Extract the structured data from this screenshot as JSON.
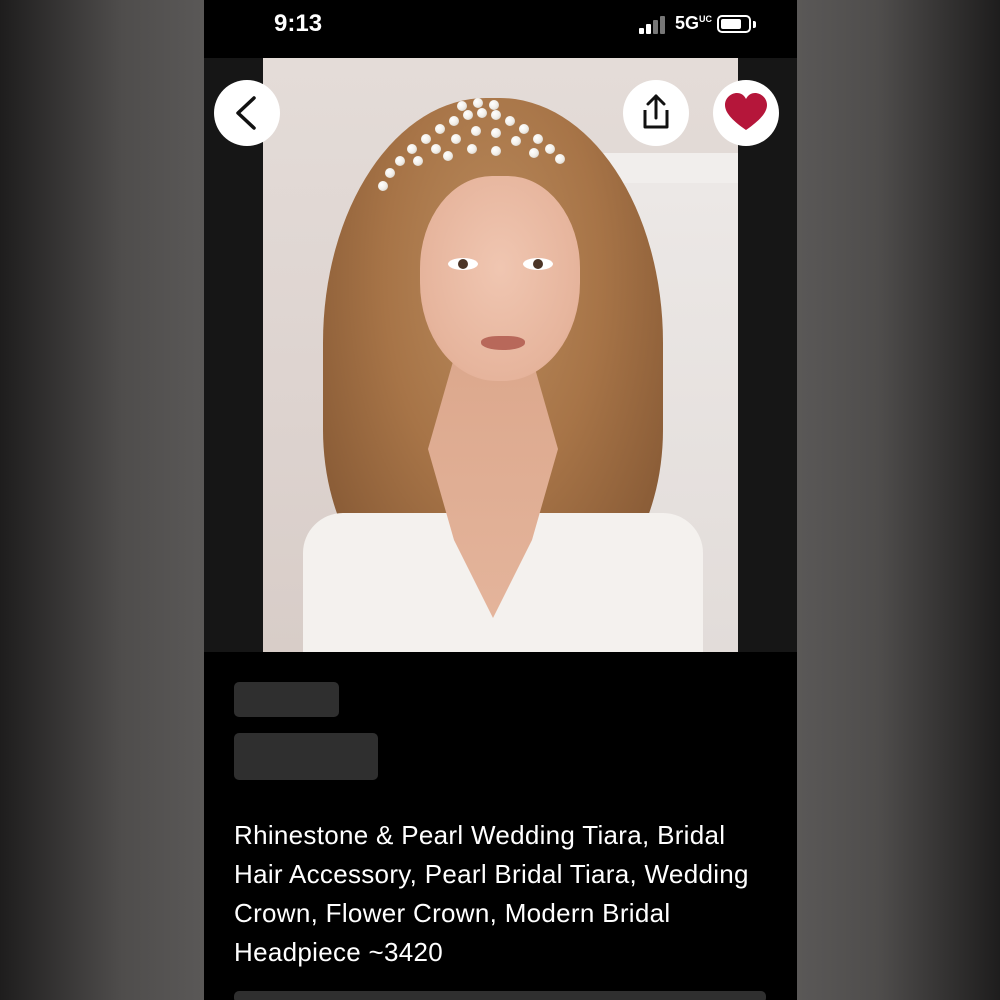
{
  "status_bar": {
    "time": "9:13",
    "network": "5G",
    "network_sup": "UC"
  },
  "listing": {
    "title": "Rhinestone & Pearl Wedding Tiara, Bridal Hair Accessory, Pearl Bridal Tiara, Wedding Crown, Flower Crown, Modern Bridal Headpiece ~3420"
  },
  "icons": {
    "back": "chevron-left-icon",
    "share": "share-icon",
    "favorite": "heart-icon"
  },
  "colors": {
    "favorite_heart": "#b5163a",
    "background": "#000000",
    "placeholder": "#2f2f2f"
  }
}
